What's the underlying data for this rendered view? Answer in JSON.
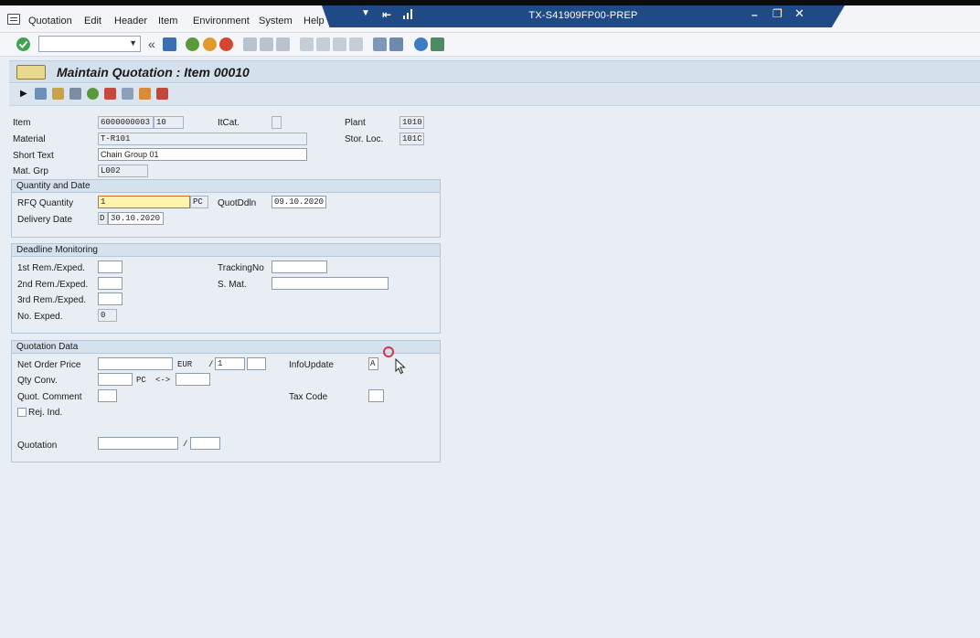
{
  "menu": {
    "items": [
      {
        "label": "Quotation"
      },
      {
        "label": "Edit"
      },
      {
        "label": "Header"
      },
      {
        "label": "Item"
      },
      {
        "label": "Environment"
      },
      {
        "label": "System"
      },
      {
        "label": "Help"
      }
    ]
  },
  "window": {
    "system_title": "TX-S41909FP00-PREP"
  },
  "command_field": {
    "value": ""
  },
  "screen": {
    "title": "Maintain Quotation : Item 00010"
  },
  "header_fields": {
    "item_label": "Item",
    "item_doc": "6000000003",
    "item_no": "10",
    "itcat_label": "ItCat.",
    "itcat_value": "",
    "plant_label": "Plant",
    "plant_value": "1010",
    "material_label": "Material",
    "material_value": "T-R101",
    "storloc_label": "Stor. Loc.",
    "storloc_value": "101C",
    "short_text_label": "Short Text",
    "short_text_value": "Chain Group 01",
    "matgrp_label": "Mat. Grp",
    "matgrp_value": "L002"
  },
  "qty_date": {
    "title": "Quantity and Date",
    "rfq_qty_label": "RFQ Quantity",
    "rfq_qty_value": "1",
    "rfq_unit": "PC",
    "quotddln_label": "QuotDdln",
    "quotddln_value": "09.10.2020",
    "delivery_label": "Delivery Date",
    "delivery_format": "D",
    "delivery_value": "30.10.2020"
  },
  "deadline": {
    "title": "Deadline Monitoring",
    "rem1_label": "1st Rem./Exped.",
    "rem2_label": "2nd Rem./Exped.",
    "rem3_label": "3rd Rem./Exped.",
    "noexped_label": "No. Exped.",
    "noexped_value": "0",
    "tracking_label": "TrackingNo",
    "smat_label": "S. Mat."
  },
  "quotation_data": {
    "title": "Quotation Data",
    "net_price_label": "Net Order Price",
    "currency": "EUR",
    "slash": "/",
    "per_value": "1",
    "info_update_label": "InfoUpdate",
    "info_update_value": "A",
    "qty_conv_label": "Qty Conv.",
    "qty_unit": "PC",
    "conv_arrow": "<->",
    "quot_comment_label": "Quot. Comment",
    "tax_code_label": "Tax Code",
    "rej_ind_label": "Rej. Ind.",
    "quotation_label": "Quotation"
  }
}
